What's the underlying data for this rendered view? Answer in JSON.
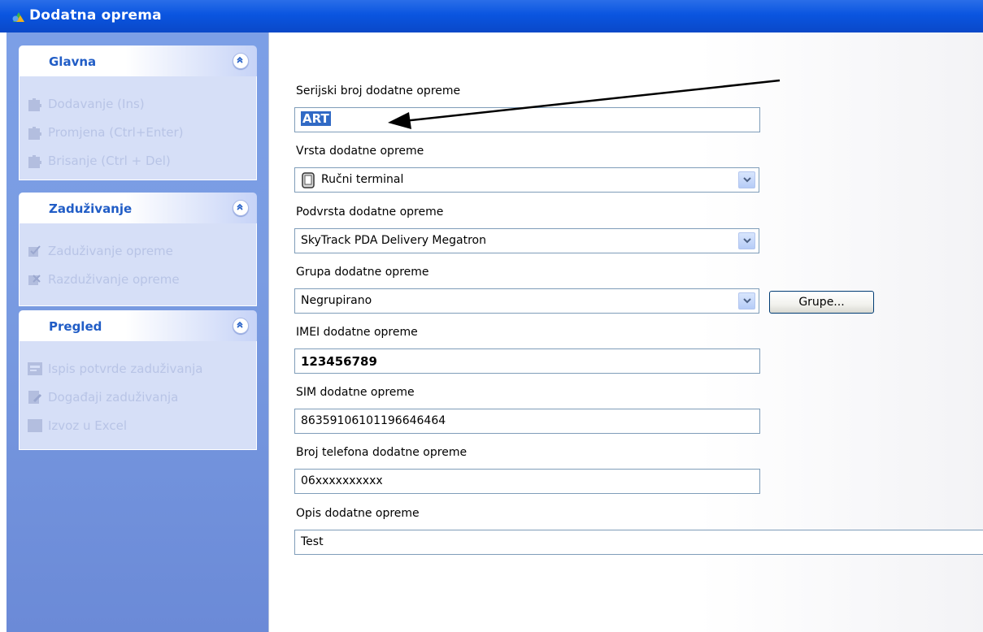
{
  "window": {
    "title": "Dodatna oprema",
    "icon": "app-globe-icon"
  },
  "taskpane": {
    "groups": [
      {
        "title": "Glavna",
        "tasks": [
          {
            "label": "Dodavanje (Ins)",
            "icon": "puzzle-icon"
          },
          {
            "label": "Promjena (Ctrl+Enter)",
            "icon": "puzzle-icon"
          },
          {
            "label": "Brisanje (Ctrl + Del)",
            "icon": "puzzle-icon"
          }
        ]
      },
      {
        "title": "Zaduživanje",
        "tasks": [
          {
            "label": "Zaduživanje opreme",
            "icon": "checkbox-icon"
          },
          {
            "label": "Razduživanje opreme",
            "icon": "uncheck-icon"
          }
        ]
      },
      {
        "title": "Pregled",
        "tasks": [
          {
            "label": "Ispis potvrde zaduživanja",
            "icon": "print-form-icon"
          },
          {
            "label": "Događaji zaduživanja",
            "icon": "document-edit-icon"
          },
          {
            "label": "Izvoz u Excel",
            "icon": "excel-icon"
          }
        ]
      }
    ]
  },
  "form": {
    "serial": {
      "label": "Serijski broj dodatne opreme",
      "value": "ART"
    },
    "type": {
      "label": "Vrsta dodatne opreme",
      "value": "Ručni terminal",
      "icon": "handheld-terminal-icon"
    },
    "subtype": {
      "label": "Podvrsta dodatne opreme",
      "value": "SkyTrack PDA Delivery Megatron"
    },
    "group": {
      "label": "Grupa dodatne opreme",
      "value": "Negrupirano",
      "button": "Grupe..."
    },
    "imei": {
      "label": "IMEI dodatne opreme",
      "value": "123456789"
    },
    "sim": {
      "label": "SIM dodatne opreme",
      "value": "86359106101196646464"
    },
    "phone": {
      "label": "Broj telefona dodatne opreme",
      "value": "06xxxxxxxxxx"
    },
    "description": {
      "label": "Opis dodatne opreme",
      "value": "Test"
    }
  },
  "colors": {
    "titlebar": "#0a55e0",
    "group_title": "#215dc6",
    "selection": "#316ac5"
  }
}
